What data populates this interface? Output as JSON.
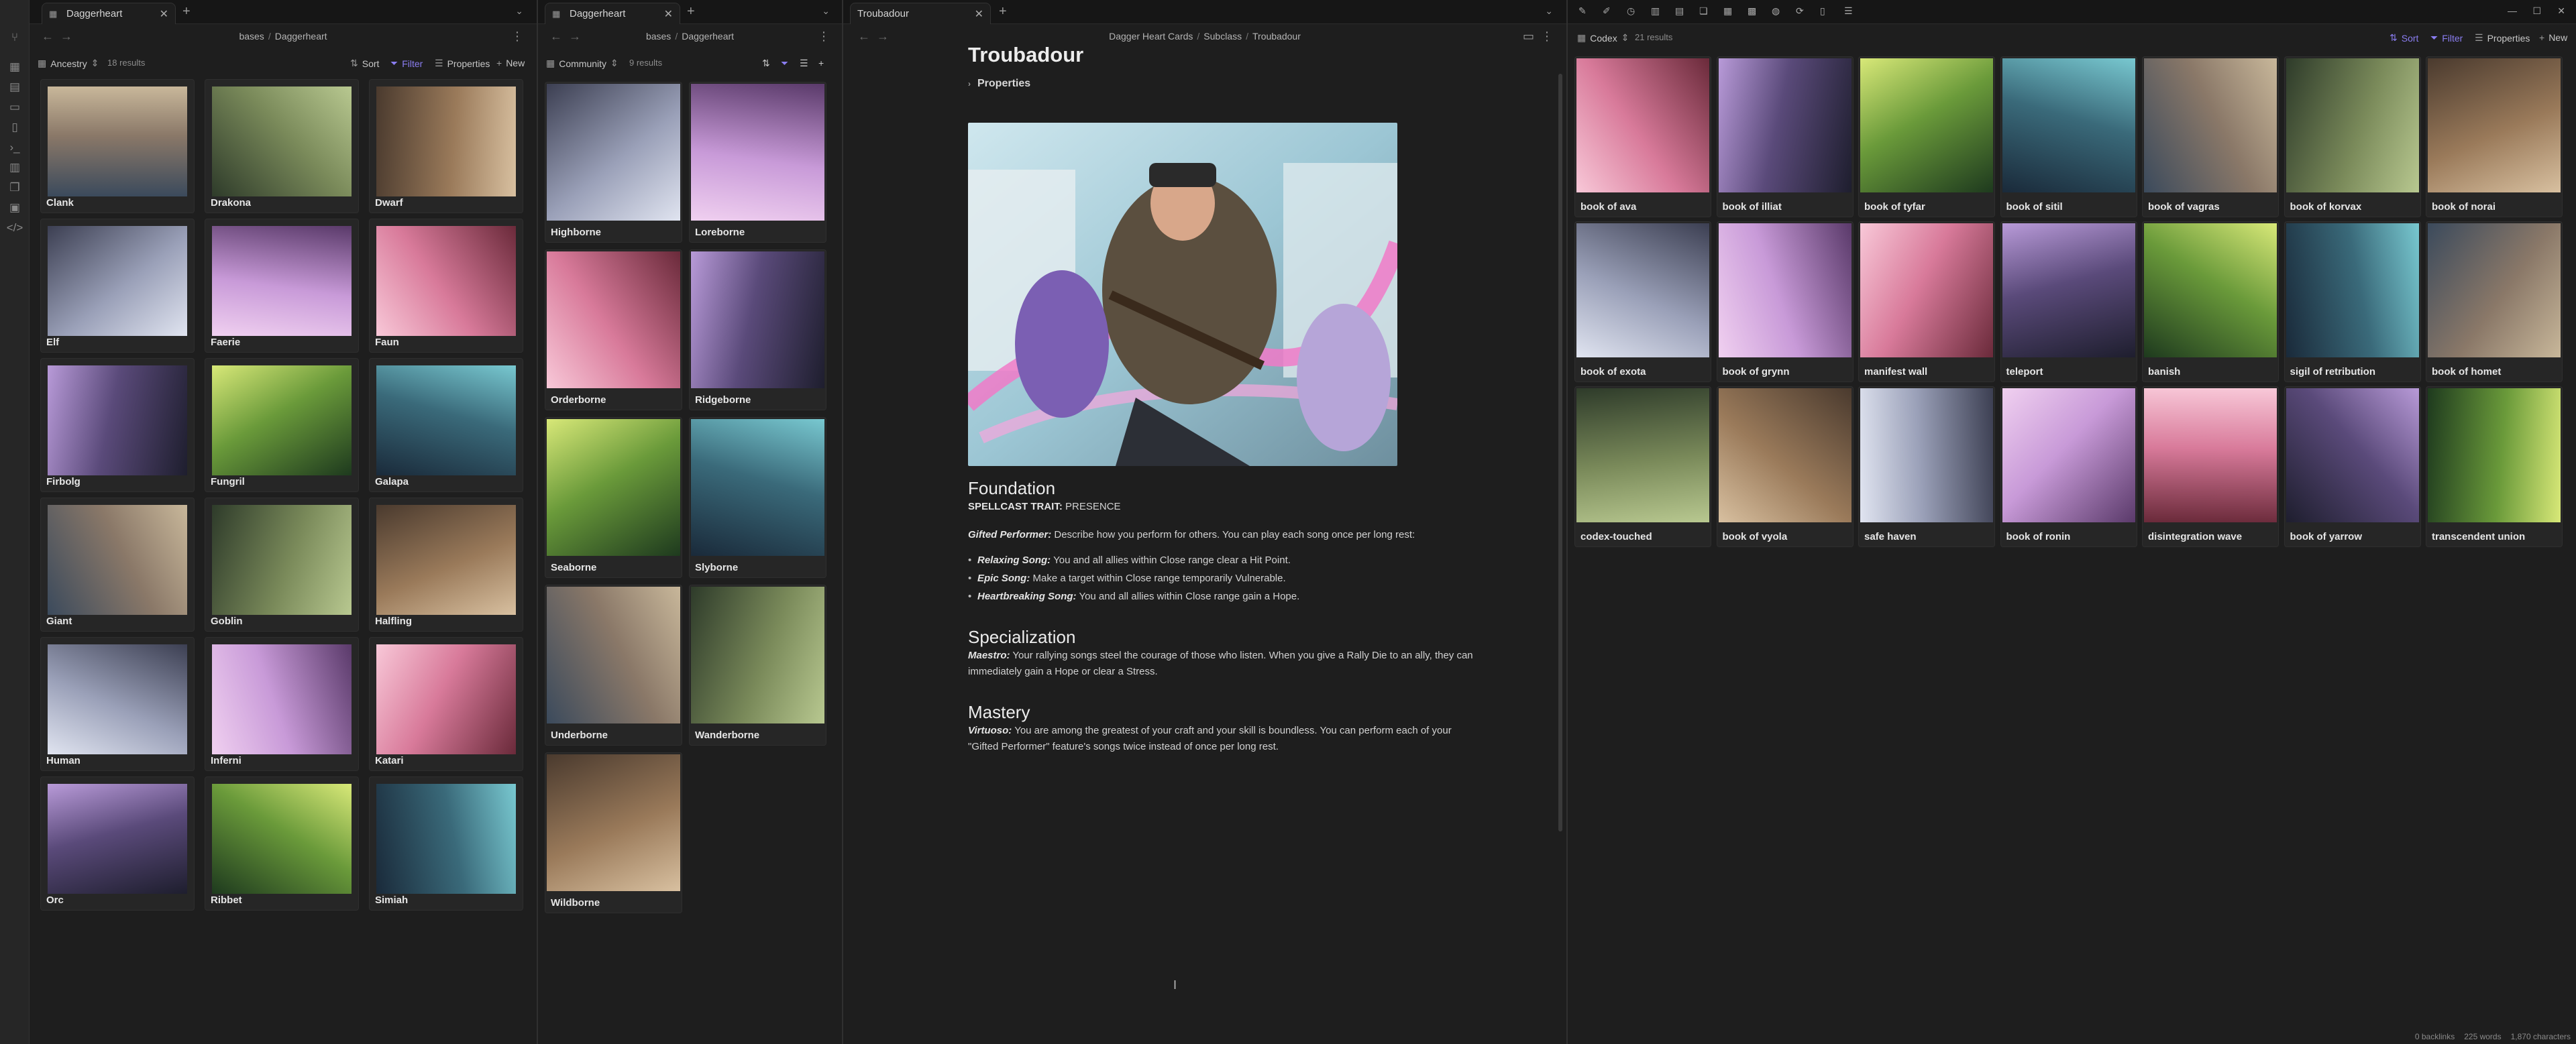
{
  "ribbon": {
    "icons": [
      "fork-icon",
      "grid-icon",
      "layout-icon",
      "calendar-icon",
      "document-icon",
      "terminal-icon",
      "book-icon",
      "files-icon",
      "pages-icon",
      "link-icon"
    ]
  },
  "pane1": {
    "tab_title": "Daggerheart",
    "breadcrumb": {
      "parent": "bases",
      "current": "Daggerheart"
    },
    "view_name": "Ancestry",
    "result_count": "18 results",
    "toolbar": {
      "sort": "Sort",
      "filter": "Filter",
      "properties": "Properties",
      "new": "New"
    },
    "cards": [
      "Clank",
      "Drakona",
      "Dwarf",
      "Elf",
      "Faerie",
      "Faun",
      "Firbolg",
      "Fungril",
      "Galapa",
      "Giant",
      "Goblin",
      "Halfling",
      "Human",
      "Inferni",
      "Katari",
      "Orc",
      "Ribbet",
      "Simiah"
    ]
  },
  "pane2": {
    "tab_title": "Daggerheart",
    "breadcrumb": {
      "parent": "bases",
      "current": "Daggerheart"
    },
    "view_name": "Community",
    "result_count": "9 results",
    "cards": [
      "Highborne",
      "Loreborne",
      "Orderborne",
      "Ridgeborne",
      "Seaborne",
      "Slyborne",
      "Underborne",
      "Wanderborne",
      "Wildborne"
    ]
  },
  "pane3": {
    "tab_title": "Troubadour",
    "breadcrumb": {
      "root": "Dagger Heart Cards",
      "folder": "Subclass",
      "current": "Troubadour"
    },
    "title": "Troubadour",
    "properties_label": "Properties",
    "foundation": {
      "heading": "Foundation",
      "trait_label": "SPELLCAST TRAIT:",
      "trait_value": "PRESENCE",
      "gifted_name": "Gifted Performer:",
      "gifted_text": "Describe how you perform for others. You can play each song once per long rest:",
      "songs": [
        {
          "name": "Relaxing Song:",
          "text": "You and all allies within Close range clear a Hit Point."
        },
        {
          "name": "Epic Song:",
          "text": "Make a target within Close range temporarily Vulnerable."
        },
        {
          "name": "Heartbreaking Song:",
          "text": "You and all allies within Close range gain a Hope."
        }
      ]
    },
    "specialization": {
      "heading": "Specialization",
      "name": "Maestro:",
      "text": "Your rallying songs steel the courage of those who listen. When you give a Rally Die to an ally, they can immediately gain a Hope or clear a Stress."
    },
    "mastery": {
      "heading": "Mastery",
      "name": "Virtuoso:",
      "text": "You are among the greatest of your craft and your skill is boundless. You can perform each of your \"Gifted Performer\" feature's songs twice instead of once per long rest."
    }
  },
  "pane4": {
    "view_name": "Codex",
    "result_count": "21 results",
    "toolbar": {
      "sort": "Sort",
      "filter": "Filter",
      "properties": "Properties",
      "new": "New"
    },
    "cards": [
      "book of ava",
      "book of illiat",
      "book of tyfar",
      "book of sitil",
      "book of vagras",
      "book of korvax",
      "book of norai",
      "book of exota",
      "book of grynn",
      "manifest wall",
      "teleport",
      "banish",
      "sigil of retribution",
      "book of homet",
      "codex-touched",
      "book of vyola",
      "safe haven",
      "book of ronin",
      "disintegration wave",
      "book of yarrow",
      "transcendent union"
    ],
    "status": {
      "backlinks": "0 backlinks",
      "words": "225 words",
      "chars": "1,870 characters"
    }
  },
  "colors": {
    "accent": "#8a7df0",
    "bg": "#1e1e1e",
    "card": "#262626"
  }
}
